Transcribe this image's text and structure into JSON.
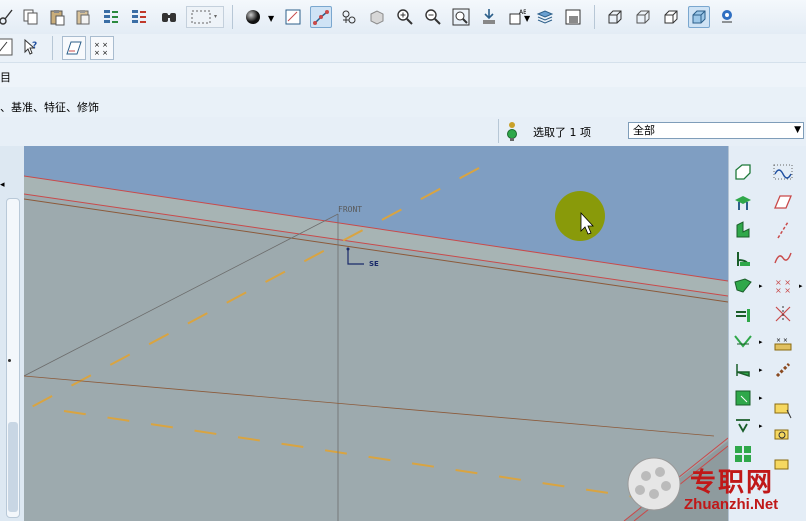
{
  "ribbon": {
    "row2_partial_label": "目",
    "row3_partial_label": "、基准、特征、修饰"
  },
  "status": {
    "selection_text": "选取了 1 项",
    "filter_value": "全部"
  },
  "viewport": {
    "datum_label": "FRONT",
    "csys_label": "SE"
  },
  "watermark": {
    "brand_cn": "专职网",
    "brand_en": "Zhuanzhi.Net"
  },
  "colors": {
    "viewport_bg": "#9daaae",
    "sky": "#7f9ec2",
    "datum_red": "#c94a4a",
    "dashed_orange": "#d9a441",
    "cursor_highlight": "#8a9a00"
  },
  "icons": {
    "top_toolbar": [
      "scissors-icon",
      "copy-icon",
      "paste-icon",
      "paste-special-icon",
      "regenerate-icon",
      "regenerate-manager-icon",
      "find-icon",
      "select-box-icon",
      "shading-sphere-icon",
      "datum-plane-display-icon",
      "datum-axis-display-icon",
      "datum-point-display-icon",
      "csys-display-icon",
      "zoom-in-icon",
      "zoom-out-icon",
      "refit-icon",
      "reorient-icon",
      "saved-views-icon",
      "layers-icon",
      "view-manager-icon",
      "wireframe-icon",
      "hidden-line-icon",
      "no-hidden-icon",
      "shaded-icon",
      "spin-center-icon"
    ],
    "second_toolbar": [
      "sketch-icon",
      "whats-this-icon",
      "datum-plane-tool-icon",
      "datum-point-tool-icon"
    ],
    "right_toolbar": [
      "plane-icon",
      "curve-icon",
      "axis-tool-icon",
      "sketch-tool-icon",
      "extrude-icon",
      "line-tool-icon",
      "revolve-icon",
      "spline-icon",
      "sweep-icon",
      "point-icon",
      "hole-icon",
      "point-offset-icon",
      "round-icon",
      "dimension-icon",
      "chamfer-icon",
      "chain-icon",
      "draft-icon",
      "note-icon",
      "shell-icon",
      "datum-tag-icon",
      "pattern-icon",
      "layer-tag-icon"
    ]
  }
}
